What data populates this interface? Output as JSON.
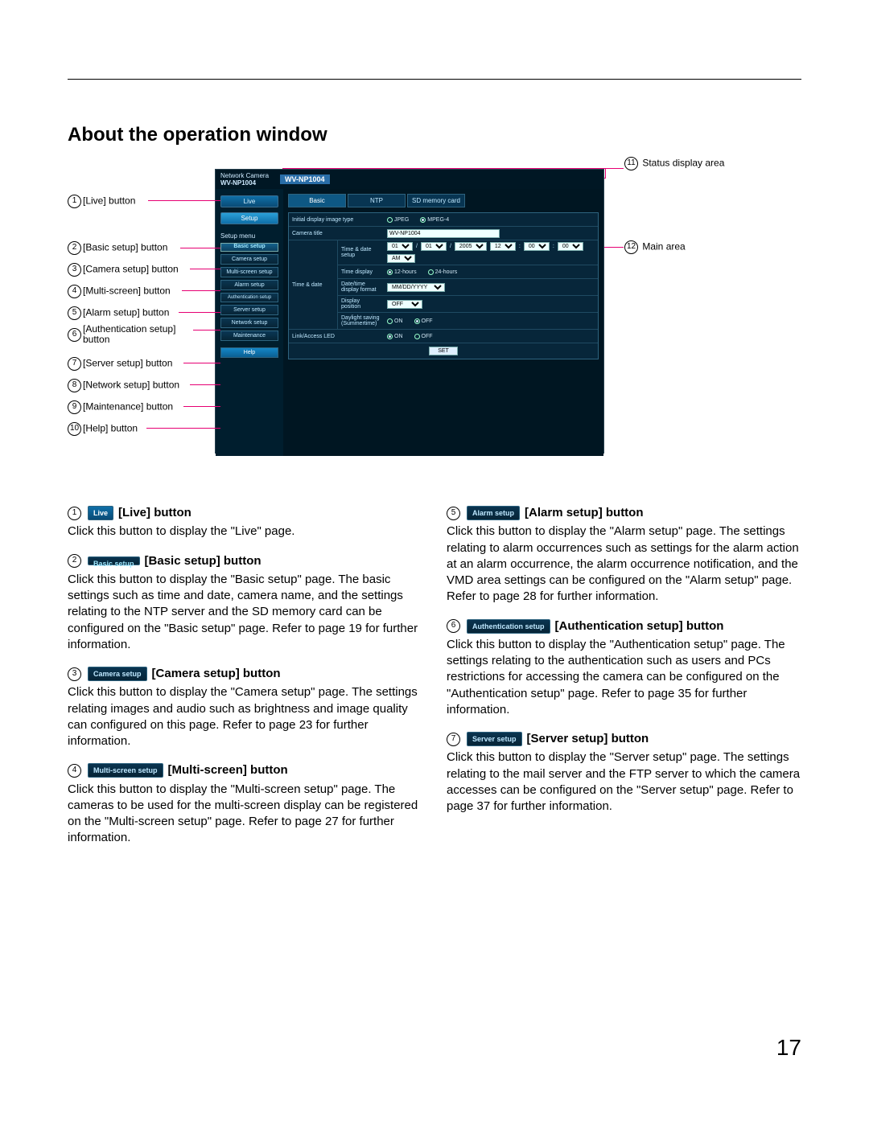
{
  "page_title": "About the operation window",
  "page_number": "17",
  "ui": {
    "brand_line1": "Network Camera",
    "brand_line2": "WV-NP1004",
    "model_tag": "WV-NP1004",
    "live_btn": "Live",
    "setup_btn": "Setup",
    "menu_heading": "Setup menu",
    "menu": [
      "Basic setup",
      "Camera setup",
      "Multi-screen setup",
      "Alarm setup",
      "Authentication setup",
      "Server setup",
      "Network setup",
      "Maintenance",
      "Help"
    ],
    "tabs": [
      "Basic",
      "NTP",
      "SD memory card"
    ],
    "row_image_type": "Initial display image type",
    "row_image_type_opts": [
      "JPEG",
      "MPEG-4"
    ],
    "row_title": "Camera title",
    "row_title_value": "WV-NP1004",
    "group_time": "Time & date",
    "row_tds": "Time & date setup",
    "row_tds_vals": [
      "01",
      "01",
      "2005",
      "12",
      "00",
      "00",
      "AM"
    ],
    "row_td": "Time display",
    "row_td_opts": [
      "12-hours",
      "24-hours"
    ],
    "row_df": "Date/time display format",
    "row_df_val": "MM/DD/YYYY",
    "row_dp": "Display position",
    "row_dp_val": "OFF",
    "row_ds": "Daylight saving (Summertime)",
    "row_ds_opts": [
      "ON",
      "OFF"
    ],
    "row_led": "Link/Access LED",
    "row_led_opts": [
      "ON",
      "OFF"
    ],
    "set_btn": "SET"
  },
  "callouts_left": [
    {
      "n": "1",
      "label": "[Live] button"
    },
    {
      "n": "2",
      "label": "[Basic setup] button"
    },
    {
      "n": "3",
      "label": "[Camera setup] button"
    },
    {
      "n": "4",
      "label": "[Multi-screen] button"
    },
    {
      "n": "5",
      "label": "[Alarm setup] button"
    },
    {
      "n": "6",
      "label": "[Authentication setup] button"
    },
    {
      "n": "7",
      "label": "[Server setup] button"
    },
    {
      "n": "8",
      "label": "[Network setup] button"
    },
    {
      "n": "9",
      "label": "[Maintenance] button"
    },
    {
      "n": "10",
      "label": "[Help] button"
    }
  ],
  "callouts_right": [
    {
      "n": "11",
      "label": "Status display area"
    },
    {
      "n": "12",
      "label": "Main area"
    }
  ],
  "descriptions_left": [
    {
      "n": "1",
      "chip": "Live",
      "chip_class": "live",
      "title": "[Live] button",
      "body": "Click this button to display the \"Live\" page."
    },
    {
      "n": "2",
      "chip": "Basic setup",
      "chip_class": "sel",
      "title": "[Basic setup] button",
      "body": "Click this button to display the \"Basic setup\" page. The basic settings such as time and date, camera name, and the settings relating to the NTP server and the SD memory card can be configured on the \"Basic setup\" page. Refer to page 19 for further information."
    },
    {
      "n": "3",
      "chip": "Camera setup",
      "chip_class": "",
      "title": "[Camera setup] button",
      "body": "Click this button to display the \"Camera setup\" page. The settings relating images and audio such as brightness and image quality can configured on this page. Refer to page 23 for further information."
    },
    {
      "n": "4",
      "chip": "Multi-screen setup",
      "chip_class": "",
      "title": "[Multi-screen] button",
      "body": "Click this button to display the \"Multi-screen setup\" page. The cameras to be used for the multi-screen display can be registered on the \"Multi-screen setup\" page. Refer to page 27 for further information."
    }
  ],
  "descriptions_right": [
    {
      "n": "5",
      "chip": "Alarm setup",
      "chip_class": "",
      "title": "[Alarm setup] button",
      "body": "Click this button to display the \"Alarm setup\" page. The settings relating to alarm occurrences such as settings for the alarm action at an alarm occurrence, the alarm occurrence notification, and the VMD area settings can be configured on the \"Alarm setup\" page. Refer to page 28 for further information."
    },
    {
      "n": "6",
      "chip": "Authentication setup",
      "chip_class": "",
      "title": "[Authentication setup] button",
      "body": "Click this button to display the \"Authentication setup\" page. The settings relating to the authentication such as users and PCs restrictions for accessing the camera can be configured on the \"Authentication setup\" page. Refer to page 35 for further information."
    },
    {
      "n": "7",
      "chip": "Server setup",
      "chip_class": "",
      "title": "[Server setup] button",
      "body": "Click this button to display the \"Server setup\" page. The settings relating to the mail server and the FTP server to which the camera accesses can be configured on the \"Server setup\" page. Refer to page 37 for further information."
    }
  ]
}
